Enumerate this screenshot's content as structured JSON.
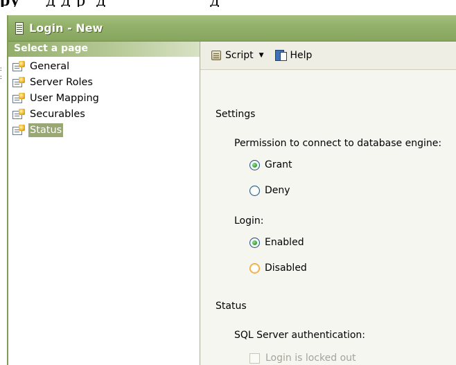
{
  "document": {
    "heading_fragment": "ру",
    "heading_rest": "     д д р  д                    д"
  },
  "window": {
    "title": "Login - New",
    "accent": "#86a55d"
  },
  "sidebar": {
    "header": "Select a page",
    "items": [
      {
        "label": "General"
      },
      {
        "label": "Server Roles"
      },
      {
        "label": "User Mapping"
      },
      {
        "label": "Securables"
      },
      {
        "label": "Status",
        "selected": true
      }
    ]
  },
  "toolbar": {
    "script_label": "Script",
    "help_label": "Help"
  },
  "settings": {
    "section": "Settings",
    "permission_label": "Permission to connect to database engine:",
    "grant_label": "Grant",
    "deny_label": "Deny",
    "permission_value": "Grant",
    "login_label": "Login:",
    "enabled_label": "Enabled",
    "disabled_label": "Disabled",
    "login_value": "Enabled"
  },
  "status": {
    "section": "Status",
    "sql_auth_label": "SQL Server authentication:",
    "locked_out_label": "Login is locked out",
    "locked_out_checked": false,
    "locked_out_enabled": false
  }
}
